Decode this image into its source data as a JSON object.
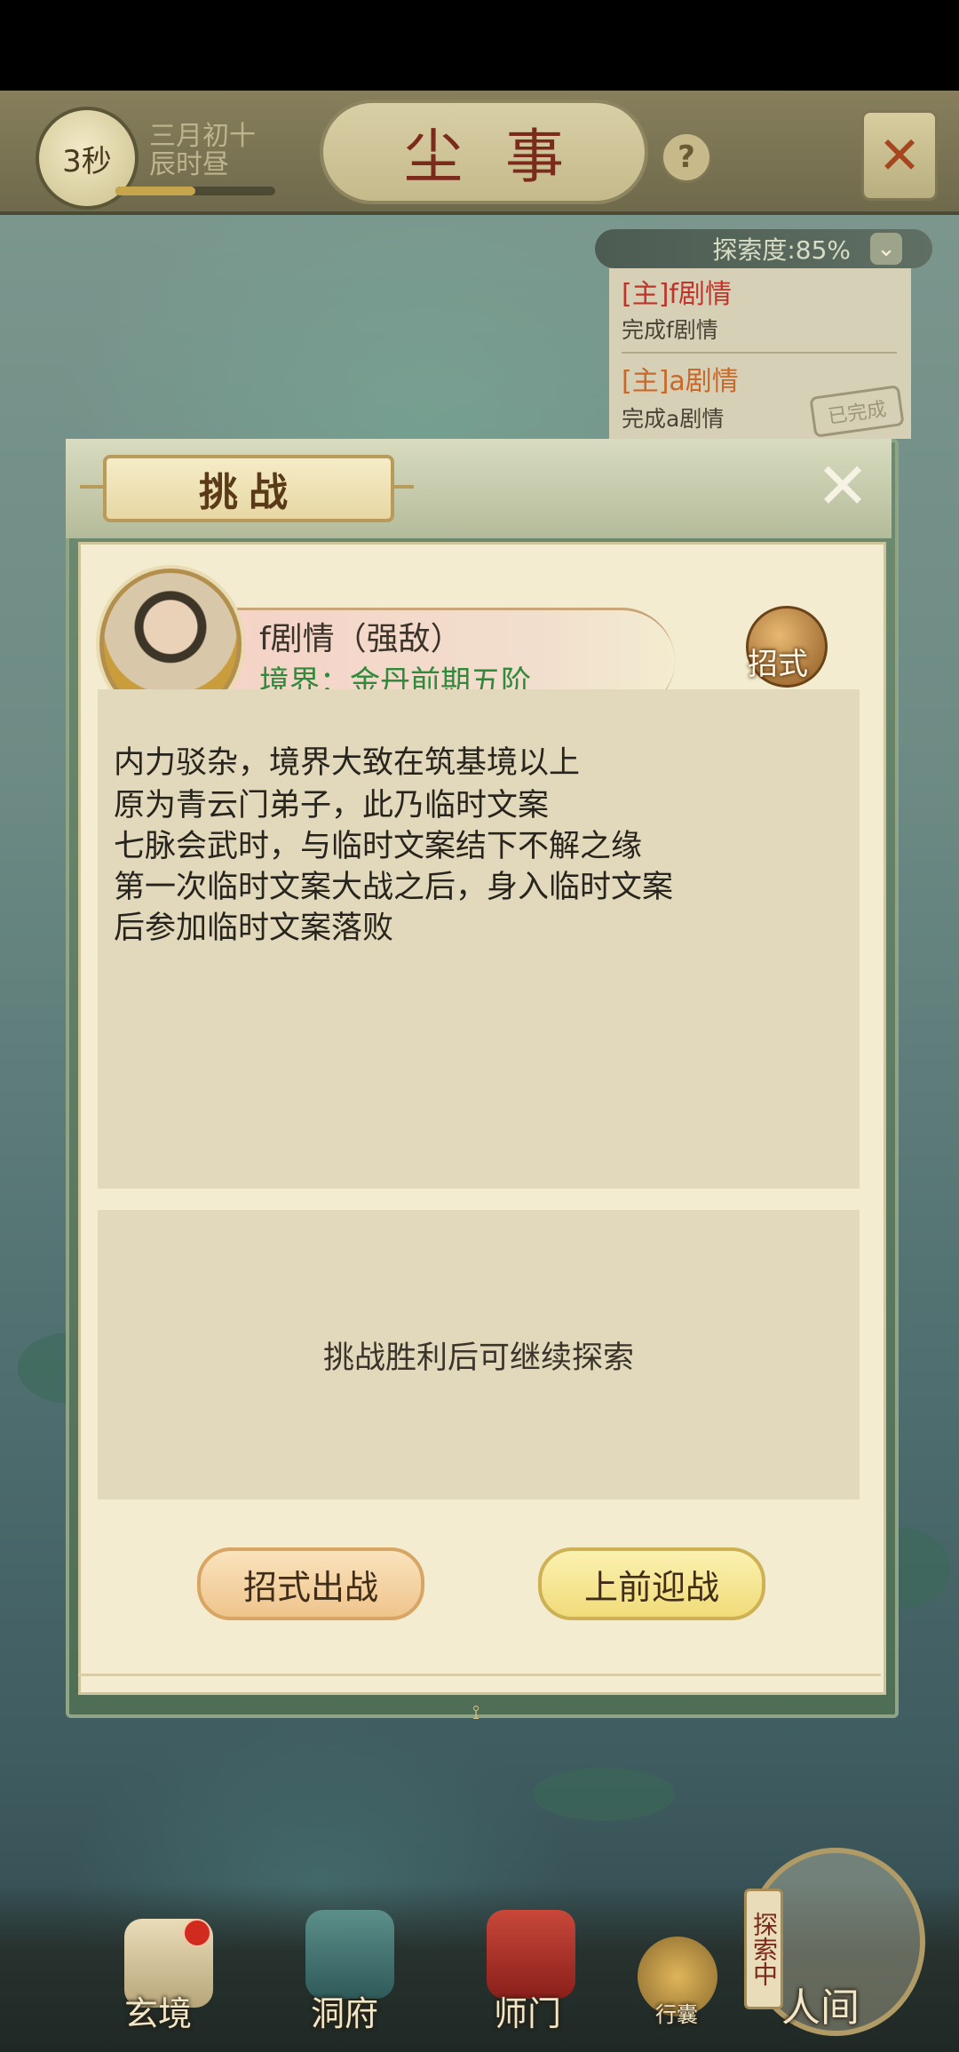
{
  "topbar": {
    "timer": "3秒",
    "date_line1": "三月初十",
    "date_line2": "辰时昼",
    "title": "尘事",
    "help": "?"
  },
  "quest_panel": {
    "explore_progress": "探索度:85%",
    "quests": [
      {
        "title": "[主]f剧情",
        "subtitle": "完成f剧情",
        "title_color": "#c0342b"
      },
      {
        "title": "[主]a剧情",
        "subtitle": "完成a剧情",
        "title_color": "#c9682b"
      }
    ],
    "done_stamp": "已完成"
  },
  "dialog": {
    "title": "挑战",
    "enemy": {
      "name": "f剧情（强敌）",
      "realm": "境界：金丹前期五阶",
      "skill_label": "招式"
    },
    "description": [
      "内力驳杂，境界大致在筑基境以上",
      "原为青云门弟子，此乃临时文案",
      "七脉会武时，与临时文案结下不解之缘",
      "第一次临时文案大战之后，身入临时文案",
      "后参加临时文案落败"
    ],
    "hint": "挑战胜利后可继续探索",
    "buttons": {
      "skill_battle": "招式出战",
      "go_fight": "上前迎战"
    }
  },
  "bottom_nav": {
    "items": [
      "玄境",
      "洞府",
      "师门",
      "行囊",
      "人间"
    ],
    "explore_tag": "探索中"
  },
  "colors": {
    "realm_green": "#2f8a3c",
    "title_red": "#7a2b1c",
    "panel_green": "#6e8b70"
  }
}
